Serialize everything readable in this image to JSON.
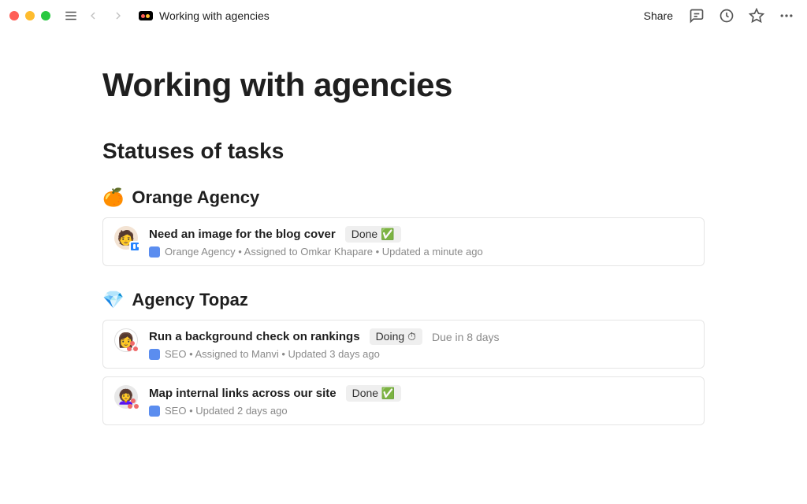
{
  "topbar": {
    "breadcrumb": "Working with agencies",
    "share": "Share"
  },
  "page": {
    "title": "Working with agencies",
    "subtitle": "Statuses of tasks"
  },
  "sections": [
    {
      "emoji": "🍊",
      "name": "Orange Agency",
      "cards": [
        {
          "title": "Need an image for the blog cover",
          "status": "Done ✅",
          "due": "",
          "meta": "Orange Agency • Assigned to Omkar Khapare • Updated a minute ago",
          "badge": "trello"
        }
      ]
    },
    {
      "emoji": "💎",
      "name": "Agency Topaz",
      "cards": [
        {
          "title": "Run a background check on rankings",
          "status": "Doing ⏱",
          "due": "Due in 8 days",
          "meta": "SEO • Assigned to Manvi • Updated 3 days ago",
          "badge": "asana"
        },
        {
          "title": "Map internal links across our site",
          "status": "Done ✅",
          "due": "",
          "meta": "SEO • Updated 2 days ago",
          "badge": "asana"
        }
      ]
    }
  ]
}
